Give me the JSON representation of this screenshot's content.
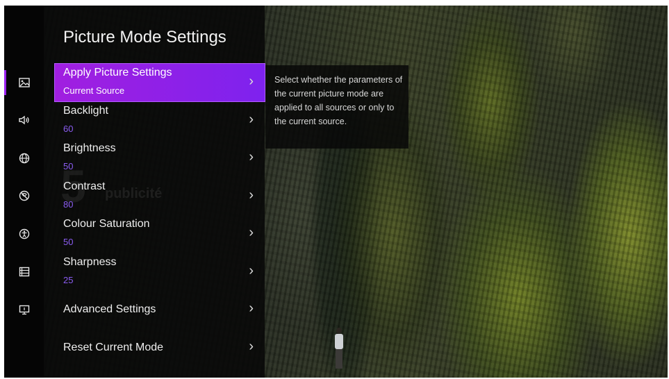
{
  "title": "Picture Mode Settings",
  "rail": {
    "icons": [
      "picture-icon",
      "sound-icon",
      "network-icon",
      "privacy-icon",
      "accessibility-icon",
      "system-icon",
      "display-icon"
    ]
  },
  "menu": [
    {
      "label": "Apply Picture Settings",
      "value": "Current Source"
    },
    {
      "label": "Backlight",
      "value": "60"
    },
    {
      "label": "Brightness",
      "value": "50"
    },
    {
      "label": "Contrast",
      "value": "80"
    },
    {
      "label": "Colour Saturation",
      "value": "50"
    },
    {
      "label": "Sharpness",
      "value": "25"
    },
    {
      "label": "Advanced Settings"
    },
    {
      "label": "Reset Current Mode"
    }
  ],
  "description": "Select whether the parameters of the current picture mode are applied to all sources or only to the current source.",
  "watermark": {
    "number": "5",
    "text": "publicité"
  },
  "chevron": "›",
  "colors": {
    "accent": "#9b22f0",
    "value": "#8a5cf0"
  }
}
